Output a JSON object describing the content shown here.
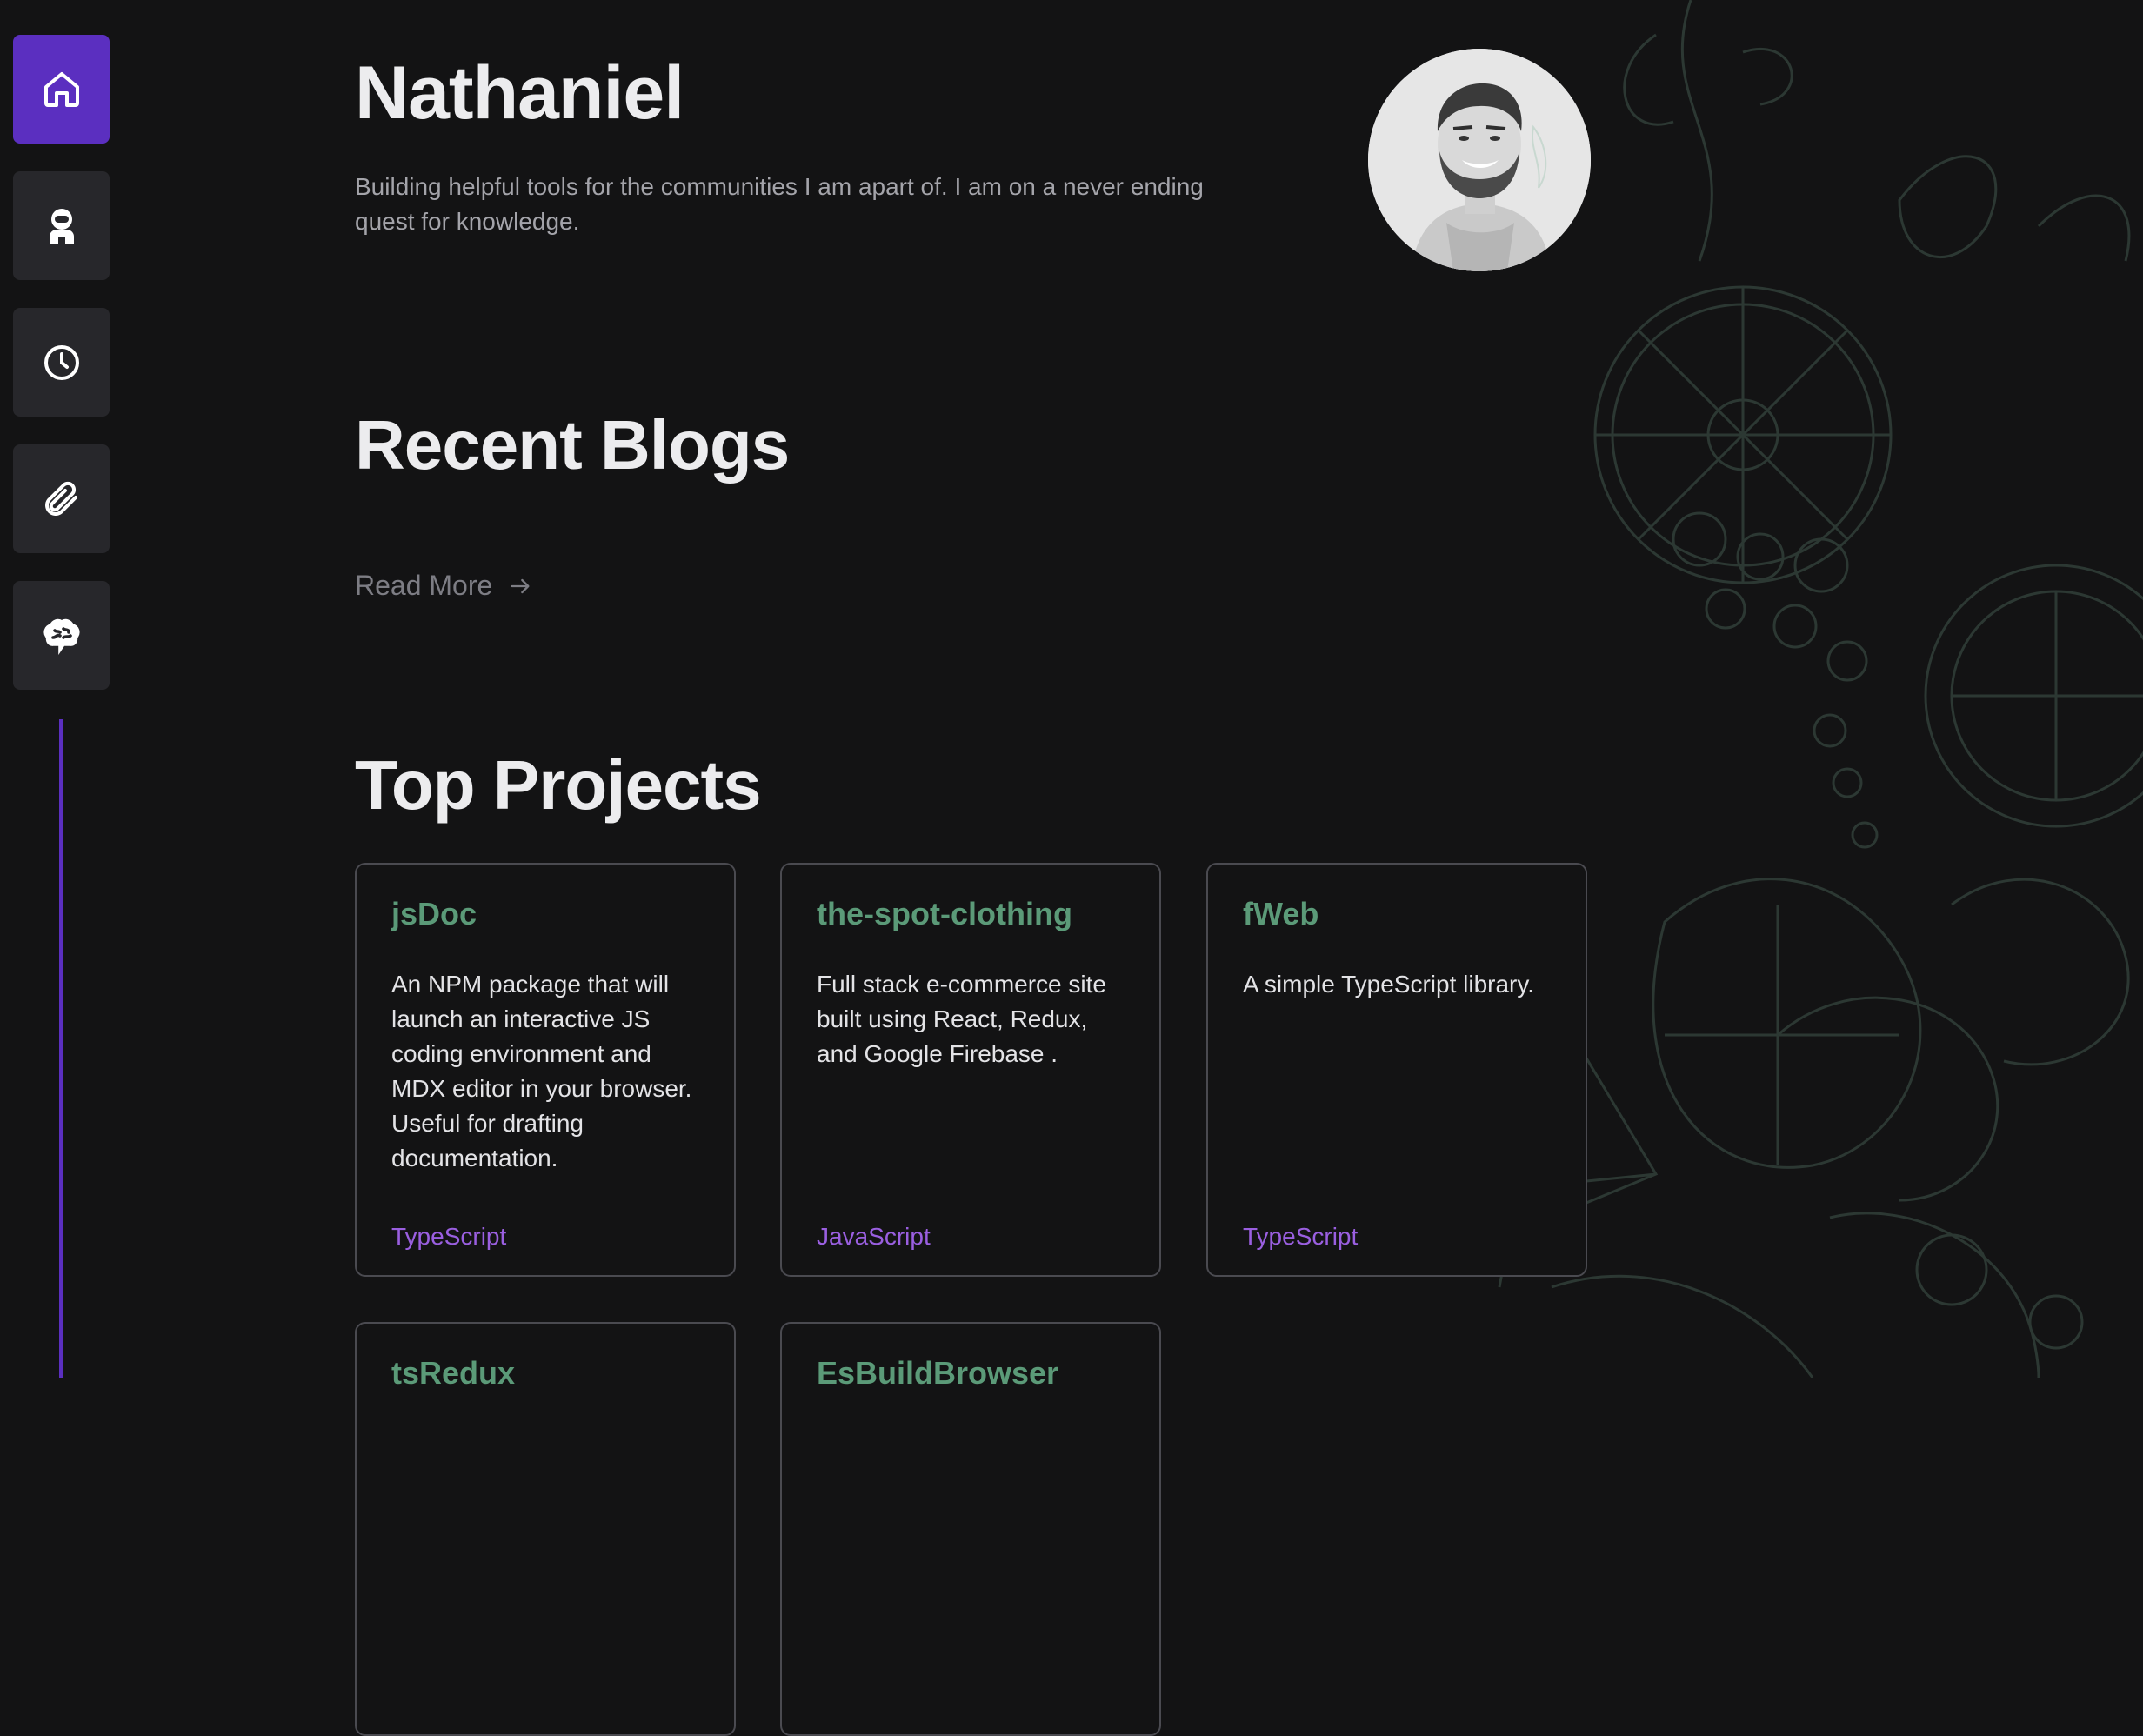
{
  "sidebar": {
    "items": [
      {
        "icon": "home-icon",
        "active": true
      },
      {
        "icon": "astronaut-icon",
        "active": false
      },
      {
        "icon": "clock-icon",
        "active": false
      },
      {
        "icon": "paperclip-icon",
        "active": false
      },
      {
        "icon": "brain-icon",
        "active": false
      }
    ],
    "accent_color": "#5b2fc0"
  },
  "hero": {
    "name": "Nathaniel",
    "bio": "Building helpful tools for the communities I am apart of. I am on a never ending quest for knowledge."
  },
  "blogs": {
    "heading": "Recent Blogs",
    "read_more": "Read More"
  },
  "projects": {
    "heading": "Top Projects",
    "items": [
      {
        "title": "jsDoc",
        "description": "An NPM package that will launch an interactive JS coding environment and MDX editor in your browser. Useful for drafting documentation.",
        "language": "TypeScript"
      },
      {
        "title": "the-spot-clothing",
        "description": "Full stack e-commerce site built using React, Redux, and Google Firebase .",
        "language": "JavaScript"
      },
      {
        "title": "fWeb",
        "description": "A simple TypeScript library.",
        "language": "TypeScript"
      },
      {
        "title": "tsRedux",
        "description": "",
        "language": ""
      },
      {
        "title": "EsBuildBrowser",
        "description": "",
        "language": ""
      }
    ]
  },
  "colors": {
    "background": "#131314",
    "project_title": "#5b9a78",
    "language": "#9a5fe0"
  }
}
